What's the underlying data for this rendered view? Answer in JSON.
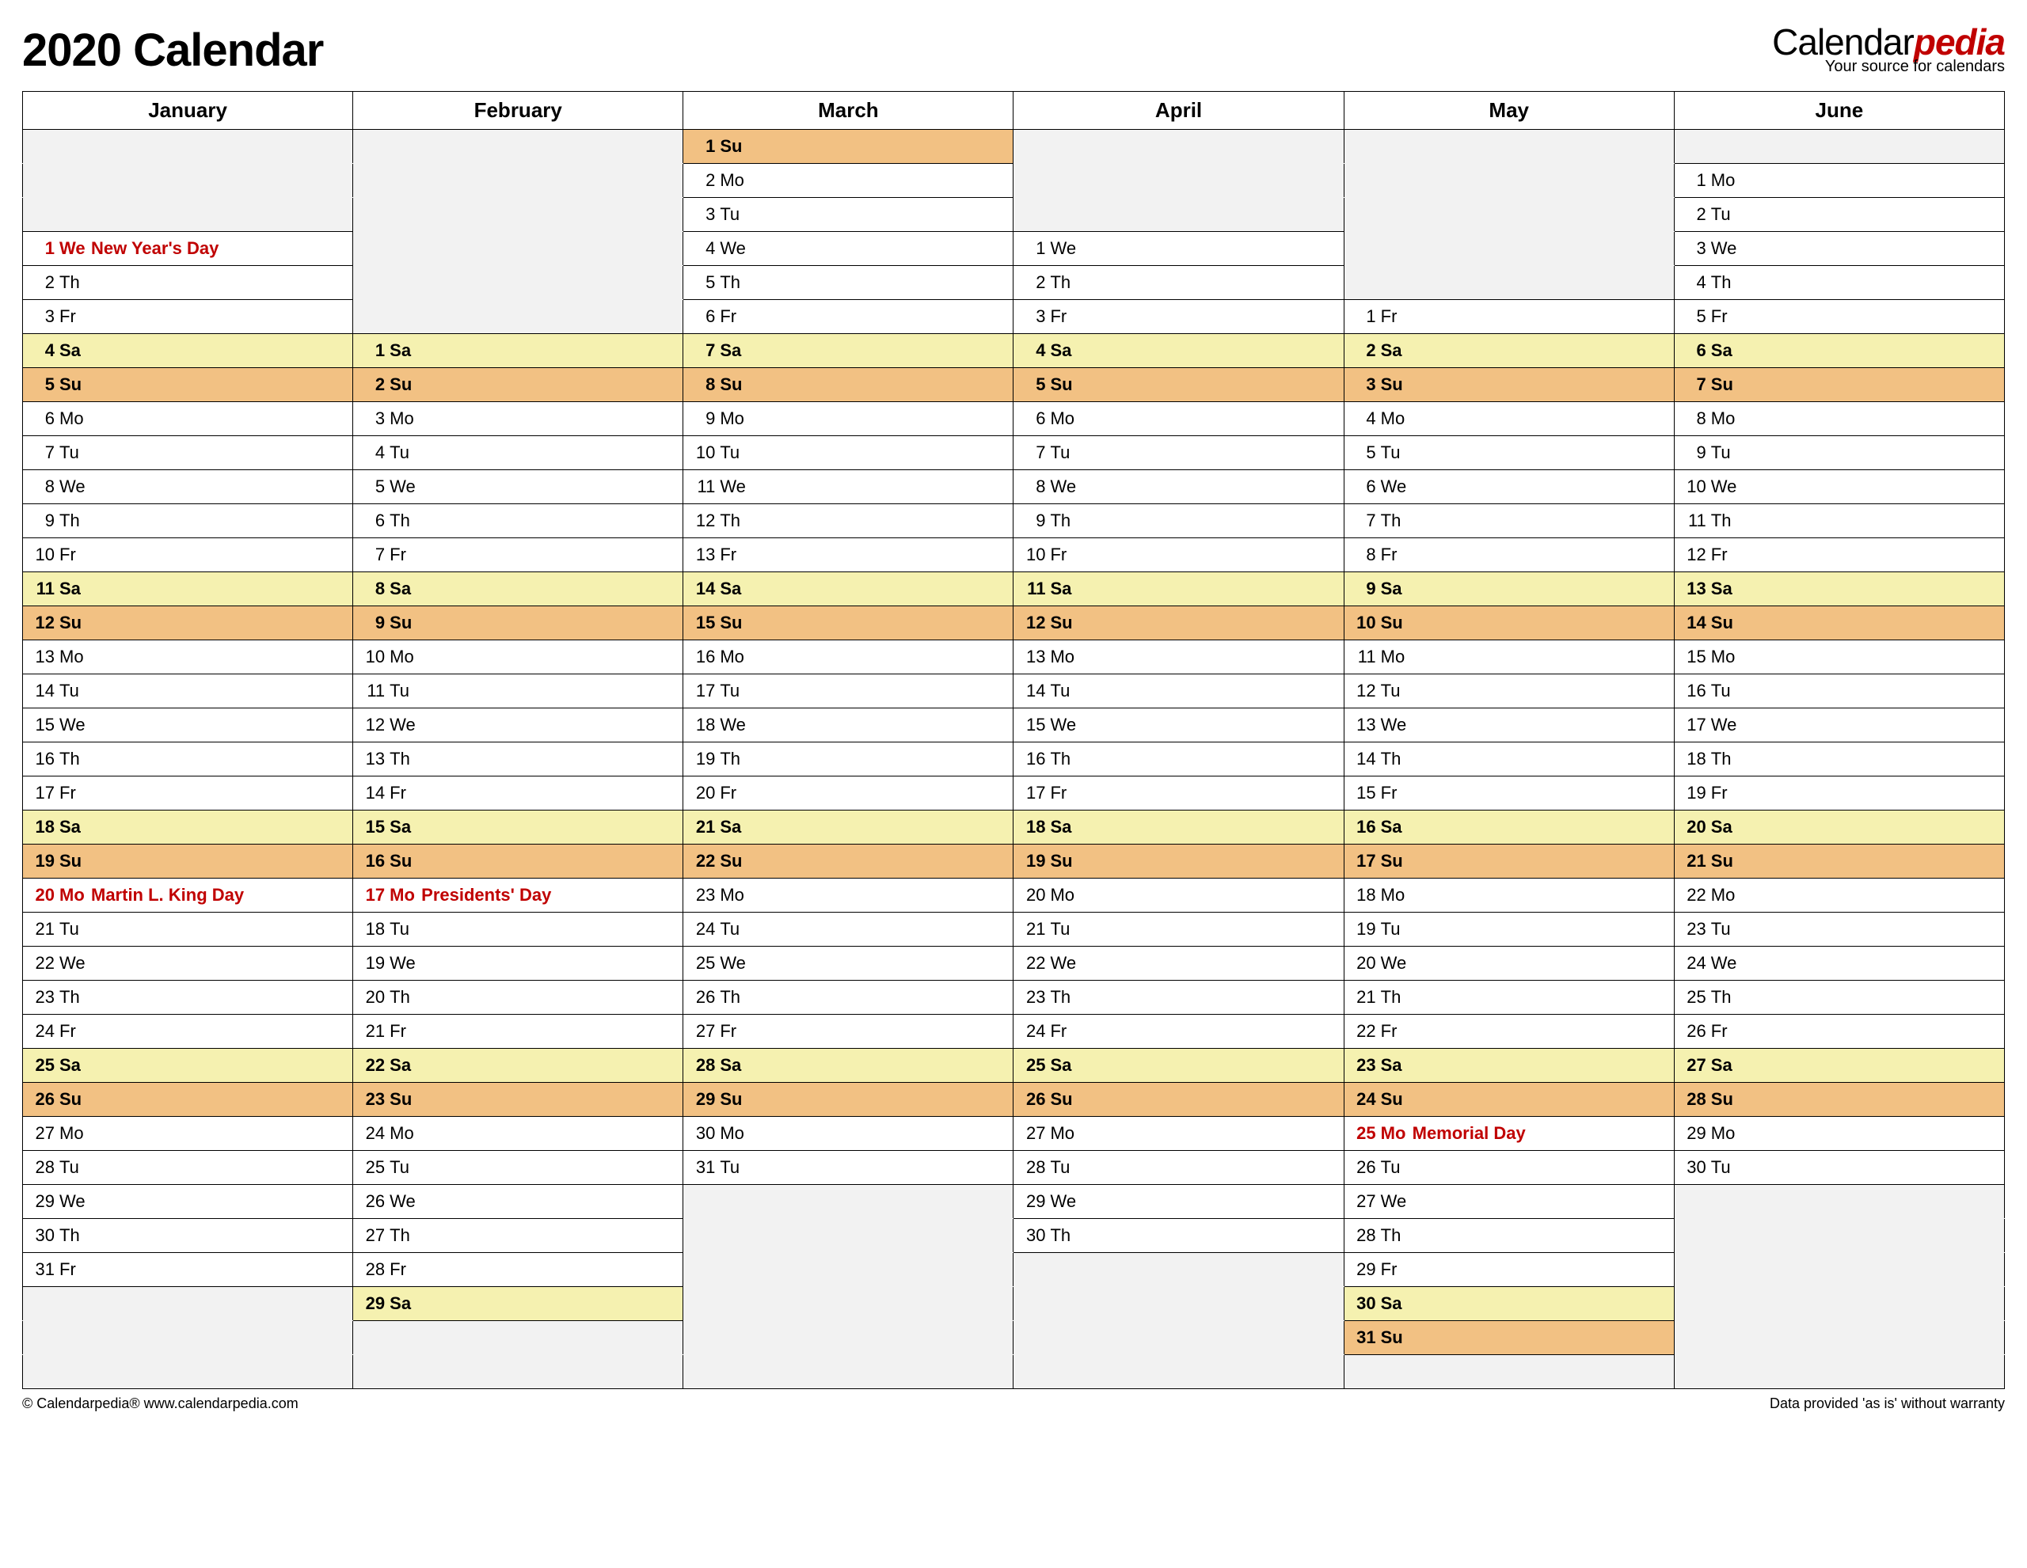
{
  "title": "2020 Calendar",
  "logo": {
    "brand": "Calendar",
    "suffix": "pedia",
    "tagline": "Your source for calendars"
  },
  "footer": {
    "left": "© Calendarpedia®   www.calendarpedia.com",
    "right": "Data provided 'as is' without warranty"
  },
  "rows": 37,
  "months": [
    {
      "name": "January",
      "offset": 3,
      "days": [
        {
          "n": 1,
          "w": "We",
          "t": "hol",
          "h": "New Year's Day"
        },
        {
          "n": 2,
          "w": "Th"
        },
        {
          "n": 3,
          "w": "Fr"
        },
        {
          "n": 4,
          "w": "Sa",
          "t": "sat"
        },
        {
          "n": 5,
          "w": "Su",
          "t": "sun"
        },
        {
          "n": 6,
          "w": "Mo"
        },
        {
          "n": 7,
          "w": "Tu"
        },
        {
          "n": 8,
          "w": "We"
        },
        {
          "n": 9,
          "w": "Th"
        },
        {
          "n": 10,
          "w": "Fr"
        },
        {
          "n": 11,
          "w": "Sa",
          "t": "sat"
        },
        {
          "n": 12,
          "w": "Su",
          "t": "sun"
        },
        {
          "n": 13,
          "w": "Mo"
        },
        {
          "n": 14,
          "w": "Tu"
        },
        {
          "n": 15,
          "w": "We"
        },
        {
          "n": 16,
          "w": "Th"
        },
        {
          "n": 17,
          "w": "Fr"
        },
        {
          "n": 18,
          "w": "Sa",
          "t": "sat"
        },
        {
          "n": 19,
          "w": "Su",
          "t": "sun"
        },
        {
          "n": 20,
          "w": "Mo",
          "t": "hol",
          "h": "Martin L. King Day"
        },
        {
          "n": 21,
          "w": "Tu"
        },
        {
          "n": 22,
          "w": "We"
        },
        {
          "n": 23,
          "w": "Th"
        },
        {
          "n": 24,
          "w": "Fr"
        },
        {
          "n": 25,
          "w": "Sa",
          "t": "sat"
        },
        {
          "n": 26,
          "w": "Su",
          "t": "sun"
        },
        {
          "n": 27,
          "w": "Mo"
        },
        {
          "n": 28,
          "w": "Tu"
        },
        {
          "n": 29,
          "w": "We"
        },
        {
          "n": 30,
          "w": "Th"
        },
        {
          "n": 31,
          "w": "Fr"
        }
      ]
    },
    {
      "name": "February",
      "offset": 6,
      "days": [
        {
          "n": 1,
          "w": "Sa",
          "t": "sat"
        },
        {
          "n": 2,
          "w": "Su",
          "t": "sun"
        },
        {
          "n": 3,
          "w": "Mo"
        },
        {
          "n": 4,
          "w": "Tu"
        },
        {
          "n": 5,
          "w": "We"
        },
        {
          "n": 6,
          "w": "Th"
        },
        {
          "n": 7,
          "w": "Fr"
        },
        {
          "n": 8,
          "w": "Sa",
          "t": "sat"
        },
        {
          "n": 9,
          "w": "Su",
          "t": "sun"
        },
        {
          "n": 10,
          "w": "Mo"
        },
        {
          "n": 11,
          "w": "Tu"
        },
        {
          "n": 12,
          "w": "We"
        },
        {
          "n": 13,
          "w": "Th"
        },
        {
          "n": 14,
          "w": "Fr"
        },
        {
          "n": 15,
          "w": "Sa",
          "t": "sat"
        },
        {
          "n": 16,
          "w": "Su",
          "t": "sun"
        },
        {
          "n": 17,
          "w": "Mo",
          "t": "hol",
          "h": "Presidents' Day"
        },
        {
          "n": 18,
          "w": "Tu"
        },
        {
          "n": 19,
          "w": "We"
        },
        {
          "n": 20,
          "w": "Th"
        },
        {
          "n": 21,
          "w": "Fr"
        },
        {
          "n": 22,
          "w": "Sa",
          "t": "sat"
        },
        {
          "n": 23,
          "w": "Su",
          "t": "sun"
        },
        {
          "n": 24,
          "w": "Mo"
        },
        {
          "n": 25,
          "w": "Tu"
        },
        {
          "n": 26,
          "w": "We"
        },
        {
          "n": 27,
          "w": "Th"
        },
        {
          "n": 28,
          "w": "Fr"
        },
        {
          "n": 29,
          "w": "Sa",
          "t": "sat"
        }
      ]
    },
    {
      "name": "March",
      "offset": 0,
      "days": [
        {
          "n": 1,
          "w": "Su",
          "t": "sun"
        },
        {
          "n": 2,
          "w": "Mo"
        },
        {
          "n": 3,
          "w": "Tu"
        },
        {
          "n": 4,
          "w": "We"
        },
        {
          "n": 5,
          "w": "Th"
        },
        {
          "n": 6,
          "w": "Fr"
        },
        {
          "n": 7,
          "w": "Sa",
          "t": "sat"
        },
        {
          "n": 8,
          "w": "Su",
          "t": "sun"
        },
        {
          "n": 9,
          "w": "Mo"
        },
        {
          "n": 10,
          "w": "Tu"
        },
        {
          "n": 11,
          "w": "We"
        },
        {
          "n": 12,
          "w": "Th"
        },
        {
          "n": 13,
          "w": "Fr"
        },
        {
          "n": 14,
          "w": "Sa",
          "t": "sat"
        },
        {
          "n": 15,
          "w": "Su",
          "t": "sun"
        },
        {
          "n": 16,
          "w": "Mo"
        },
        {
          "n": 17,
          "w": "Tu"
        },
        {
          "n": 18,
          "w": "We"
        },
        {
          "n": 19,
          "w": "Th"
        },
        {
          "n": 20,
          "w": "Fr"
        },
        {
          "n": 21,
          "w": "Sa",
          "t": "sat"
        },
        {
          "n": 22,
          "w": "Su",
          "t": "sun"
        },
        {
          "n": 23,
          "w": "Mo"
        },
        {
          "n": 24,
          "w": "Tu"
        },
        {
          "n": 25,
          "w": "We"
        },
        {
          "n": 26,
          "w": "Th"
        },
        {
          "n": 27,
          "w": "Fr"
        },
        {
          "n": 28,
          "w": "Sa",
          "t": "sat"
        },
        {
          "n": 29,
          "w": "Su",
          "t": "sun"
        },
        {
          "n": 30,
          "w": "Mo"
        },
        {
          "n": 31,
          "w": "Tu"
        }
      ]
    },
    {
      "name": "April",
      "offset": 3,
      "days": [
        {
          "n": 1,
          "w": "We"
        },
        {
          "n": 2,
          "w": "Th"
        },
        {
          "n": 3,
          "w": "Fr"
        },
        {
          "n": 4,
          "w": "Sa",
          "t": "sat"
        },
        {
          "n": 5,
          "w": "Su",
          "t": "sun"
        },
        {
          "n": 6,
          "w": "Mo"
        },
        {
          "n": 7,
          "w": "Tu"
        },
        {
          "n": 8,
          "w": "We"
        },
        {
          "n": 9,
          "w": "Th"
        },
        {
          "n": 10,
          "w": "Fr"
        },
        {
          "n": 11,
          "w": "Sa",
          "t": "sat"
        },
        {
          "n": 12,
          "w": "Su",
          "t": "sun"
        },
        {
          "n": 13,
          "w": "Mo"
        },
        {
          "n": 14,
          "w": "Tu"
        },
        {
          "n": 15,
          "w": "We"
        },
        {
          "n": 16,
          "w": "Th"
        },
        {
          "n": 17,
          "w": "Fr"
        },
        {
          "n": 18,
          "w": "Sa",
          "t": "sat"
        },
        {
          "n": 19,
          "w": "Su",
          "t": "sun"
        },
        {
          "n": 20,
          "w": "Mo"
        },
        {
          "n": 21,
          "w": "Tu"
        },
        {
          "n": 22,
          "w": "We"
        },
        {
          "n": 23,
          "w": "Th"
        },
        {
          "n": 24,
          "w": "Fr"
        },
        {
          "n": 25,
          "w": "Sa",
          "t": "sat"
        },
        {
          "n": 26,
          "w": "Su",
          "t": "sun"
        },
        {
          "n": 27,
          "w": "Mo"
        },
        {
          "n": 28,
          "w": "Tu"
        },
        {
          "n": 29,
          "w": "We"
        },
        {
          "n": 30,
          "w": "Th"
        }
      ]
    },
    {
      "name": "May",
      "offset": 5,
      "days": [
        {
          "n": 1,
          "w": "Fr"
        },
        {
          "n": 2,
          "w": "Sa",
          "t": "sat"
        },
        {
          "n": 3,
          "w": "Su",
          "t": "sun"
        },
        {
          "n": 4,
          "w": "Mo"
        },
        {
          "n": 5,
          "w": "Tu"
        },
        {
          "n": 6,
          "w": "We"
        },
        {
          "n": 7,
          "w": "Th"
        },
        {
          "n": 8,
          "w": "Fr"
        },
        {
          "n": 9,
          "w": "Sa",
          "t": "sat"
        },
        {
          "n": 10,
          "w": "Su",
          "t": "sun"
        },
        {
          "n": 11,
          "w": "Mo"
        },
        {
          "n": 12,
          "w": "Tu"
        },
        {
          "n": 13,
          "w": "We"
        },
        {
          "n": 14,
          "w": "Th"
        },
        {
          "n": 15,
          "w": "Fr"
        },
        {
          "n": 16,
          "w": "Sa",
          "t": "sat"
        },
        {
          "n": 17,
          "w": "Su",
          "t": "sun"
        },
        {
          "n": 18,
          "w": "Mo"
        },
        {
          "n": 19,
          "w": "Tu"
        },
        {
          "n": 20,
          "w": "We"
        },
        {
          "n": 21,
          "w": "Th"
        },
        {
          "n": 22,
          "w": "Fr"
        },
        {
          "n": 23,
          "w": "Sa",
          "t": "sat"
        },
        {
          "n": 24,
          "w": "Su",
          "t": "sun"
        },
        {
          "n": 25,
          "w": "Mo",
          "t": "hol",
          "h": "Memorial Day"
        },
        {
          "n": 26,
          "w": "Tu"
        },
        {
          "n": 27,
          "w": "We"
        },
        {
          "n": 28,
          "w": "Th"
        },
        {
          "n": 29,
          "w": "Fr"
        },
        {
          "n": 30,
          "w": "Sa",
          "t": "sat"
        },
        {
          "n": 31,
          "w": "Su",
          "t": "sun"
        }
      ]
    },
    {
      "name": "June",
      "offset": 1,
      "days": [
        {
          "n": 1,
          "w": "Mo"
        },
        {
          "n": 2,
          "w": "Tu"
        },
        {
          "n": 3,
          "w": "We"
        },
        {
          "n": 4,
          "w": "Th"
        },
        {
          "n": 5,
          "w": "Fr"
        },
        {
          "n": 6,
          "w": "Sa",
          "t": "sat"
        },
        {
          "n": 7,
          "w": "Su",
          "t": "sun"
        },
        {
          "n": 8,
          "w": "Mo"
        },
        {
          "n": 9,
          "w": "Tu"
        },
        {
          "n": 10,
          "w": "We"
        },
        {
          "n": 11,
          "w": "Th"
        },
        {
          "n": 12,
          "w": "Fr"
        },
        {
          "n": 13,
          "w": "Sa",
          "t": "sat"
        },
        {
          "n": 14,
          "w": "Su",
          "t": "sun"
        },
        {
          "n": 15,
          "w": "Mo"
        },
        {
          "n": 16,
          "w": "Tu"
        },
        {
          "n": 17,
          "w": "We"
        },
        {
          "n": 18,
          "w": "Th"
        },
        {
          "n": 19,
          "w": "Fr"
        },
        {
          "n": 20,
          "w": "Sa",
          "t": "sat"
        },
        {
          "n": 21,
          "w": "Su",
          "t": "sun"
        },
        {
          "n": 22,
          "w": "Mo"
        },
        {
          "n": 23,
          "w": "Tu"
        },
        {
          "n": 24,
          "w": "We"
        },
        {
          "n": 25,
          "w": "Th"
        },
        {
          "n": 26,
          "w": "Fr"
        },
        {
          "n": 27,
          "w": "Sa",
          "t": "sat"
        },
        {
          "n": 28,
          "w": "Su",
          "t": "sun"
        },
        {
          "n": 29,
          "w": "Mo"
        },
        {
          "n": 30,
          "w": "Tu"
        }
      ]
    }
  ]
}
